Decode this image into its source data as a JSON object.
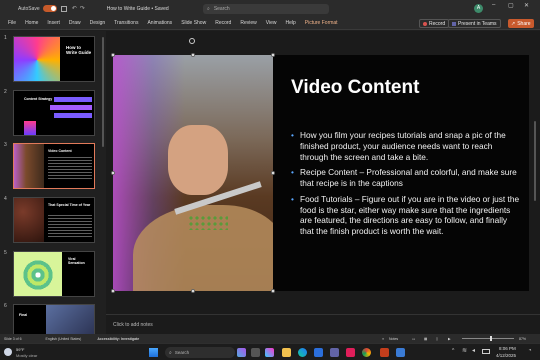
{
  "titlebar": {
    "autosave": "AutoSave",
    "document_title": "How to Write Guide • Saved",
    "search_placeholder": "Search",
    "user_initial": "A"
  },
  "ribbon": {
    "tabs": [
      "File",
      "Home",
      "Insert",
      "Draw",
      "Design",
      "Transitions",
      "Animations",
      "Slide Show",
      "Record",
      "Review",
      "View",
      "Help",
      "Picture Format"
    ],
    "record_label": "Record",
    "present_label": "Present in Teams",
    "share_label": "Share"
  },
  "thumbnails": [
    {
      "num": "1",
      "title": "How to Write Guide"
    },
    {
      "num": "2",
      "title": "Content Strategy"
    },
    {
      "num": "3",
      "title": "Video Content"
    },
    {
      "num": "4",
      "title": "That Special Time of Year"
    },
    {
      "num": "5",
      "title": "Viral Sensation"
    },
    {
      "num": "6",
      "title": "Final"
    }
  ],
  "slide": {
    "title": "Video Content",
    "bullets": [
      "How you film your recipes tutorials and snap a pic of the finished product, your audience needs want to reach through the screen and take a bite.",
      "Recipe Content – Professional and colorful, and make sure that recipe is in the captions",
      "Food Tutorials – Figure out if you are in the video or just the food is the star, either way make sure that the ingredients are featured, the directions are easy to follow, and finally that the finish product is worth the wait."
    ]
  },
  "notes": {
    "placeholder": "Click to add notes"
  },
  "status": {
    "slide_counter": "Slide 3 of 6",
    "language": "English (United States)",
    "accessibility": "Accessibility: Investigate",
    "notes_label": "Notes",
    "zoom": "87%"
  },
  "taskbar": {
    "weather_temp": "59°F",
    "weather_desc": "Mostly clear",
    "search_placeholder": "Search",
    "time": "8:06 PM",
    "date": "4/12/2025"
  },
  "colors": {
    "accent": "#e27a5a",
    "share": "#c95a2d",
    "picture_format": "#f0b38a"
  }
}
